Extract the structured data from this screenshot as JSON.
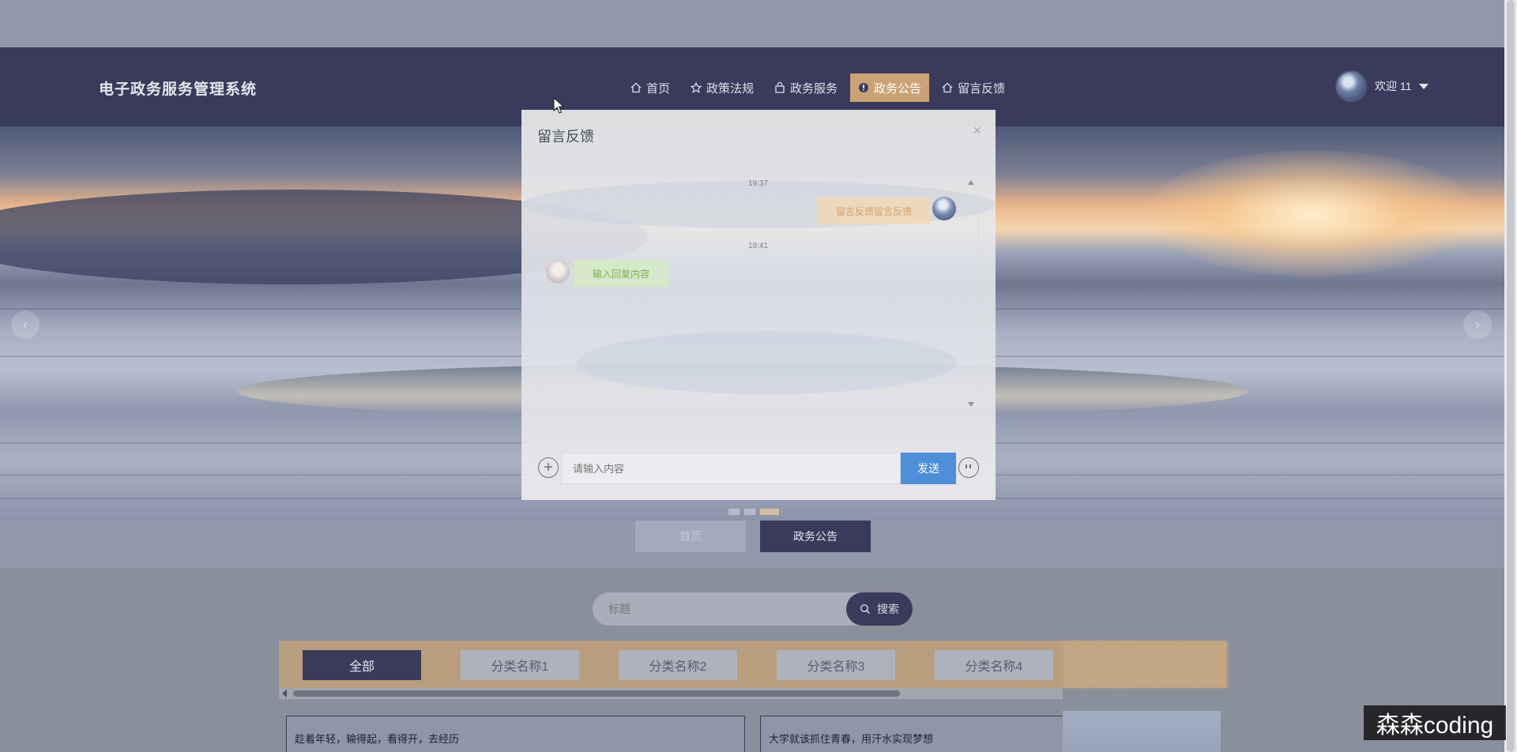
{
  "header": {
    "brand": "电子政务服务管理系统",
    "menu": [
      {
        "label": "首页",
        "icon": "home-icon",
        "active": false
      },
      {
        "label": "政策法规",
        "icon": "star-icon",
        "active": false
      },
      {
        "label": "政务服务",
        "icon": "bag-icon",
        "active": false
      },
      {
        "label": "政务公告",
        "icon": "alert-circle-icon",
        "active": true
      },
      {
        "label": "留言反馈",
        "icon": "home-icon",
        "active": false
      }
    ],
    "user": {
      "greeting": "欢迎 11"
    }
  },
  "banner": {
    "prev_glyph": "‹",
    "next_glyph": "›"
  },
  "breadcrumb": {
    "home": "首页",
    "current": "政务公告"
  },
  "search": {
    "placeholder": "标题",
    "button_label": "搜索"
  },
  "categories": [
    "全部",
    "分类名称1",
    "分类名称2",
    "分类名称3",
    "分类名称4"
  ],
  "cards": [
    {
      "title": "趁着年轻，输得起，看得开，去经历"
    },
    {
      "title": "大学就该抓住青春，用汗水实现梦想"
    }
  ],
  "modal": {
    "title": "留言反馈",
    "close_glyph": "×",
    "messages": [
      {
        "time": "19:37",
        "text": "留言反馈留言反馈",
        "from": "me"
      },
      {
        "time": "19:41",
        "text": "输入回复内容",
        "from": "admin"
      }
    ],
    "input_placeholder": "请输入内容",
    "send_label": "发送",
    "add_glyph": "+"
  },
  "watermark": "森森coding",
  "colors": {
    "nav_bg": "#3a3b5b",
    "accent": "#caa276",
    "send_button": "#4d8fd9",
    "bubble_me": "#d4a36d",
    "bubble_reply": "#7fb24f"
  }
}
